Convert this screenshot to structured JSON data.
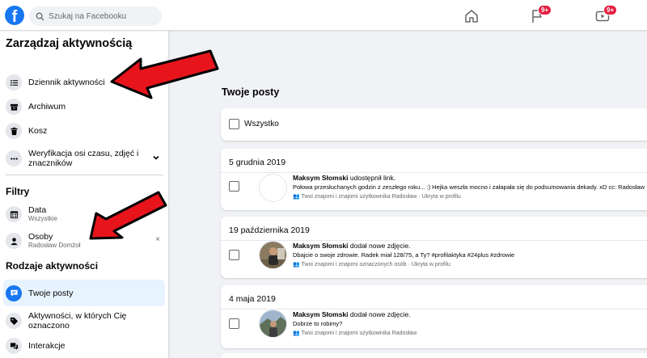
{
  "header": {
    "logo_letter": "f",
    "search_placeholder": "Szukaj na Facebooku",
    "nav": [
      {
        "icon": "home-icon"
      },
      {
        "icon": "flag-icon",
        "badge": "9+"
      },
      {
        "icon": "watch-icon",
        "badge": "9+"
      }
    ]
  },
  "sidebar": {
    "title": "Zarządzaj aktywnością",
    "items": [
      {
        "label": "Dziennik aktywności",
        "icon": "list-icon"
      },
      {
        "label": "Archiwum",
        "icon": "archive-icon"
      },
      {
        "label": "Kosz",
        "icon": "trash-icon"
      },
      {
        "label": "Weryfikacja osi czasu, zdjęć i znaczników",
        "icon": "more-icon"
      }
    ],
    "filters_title": "Filtry",
    "filters": [
      {
        "label": "Data",
        "sub": "Wszystkie",
        "icon": "calendar-icon"
      },
      {
        "label": "Osoby",
        "sub": "Radosław Domżoł",
        "icon": "person-icon",
        "clear": "×"
      }
    ],
    "activity_types_title": "Rodzaje aktywności",
    "activity_types": [
      {
        "label": "Twoje posty",
        "icon": "posts-icon",
        "active": true
      },
      {
        "label": "Aktywności, w których Cię oznaczono",
        "icon": "tag-icon"
      },
      {
        "label": "Interakcje",
        "icon": "interactions-icon"
      }
    ]
  },
  "main": {
    "heading": "Twoje posty",
    "select_all_label": "Wszystko",
    "groups": [
      {
        "date": "5 grudnia 2019",
        "author": "Maksym Słomski",
        "action": "udostępnił link.",
        "text": "Połowa przesłuchanych godzin z zeszłego roku... :) Hejka weszła mocno i załapała się do podsumowania dekady. xD cc: Radosław",
        "audience": "Twoi znajomi i znajomi użytkownika Radosław · Ukryta w profilu"
      },
      {
        "date": "19 października 2019",
        "author": "Maksym Słomski",
        "action": "dodał nowe zdjęcie.",
        "text": "Dbajcie o swoje zdrowie. Radek miał 128/75, a Ty? #profilaktyka #24plus #zdrowie",
        "audience": "Twoi znajomi i znajomi oznaczonych osób · Ukryta w profilu"
      },
      {
        "date": "4 maja 2019",
        "author": "Maksym Słomski",
        "action": "dodał nowe zdjęcie.",
        "text": "Dobrze to robimy?",
        "audience": "Twoi znajomi i znajomi użytkownika Radosław"
      }
    ]
  },
  "colors": {
    "brand": "#1877f2",
    "badge": "#e41e3f",
    "arrow": "#e8141c"
  }
}
